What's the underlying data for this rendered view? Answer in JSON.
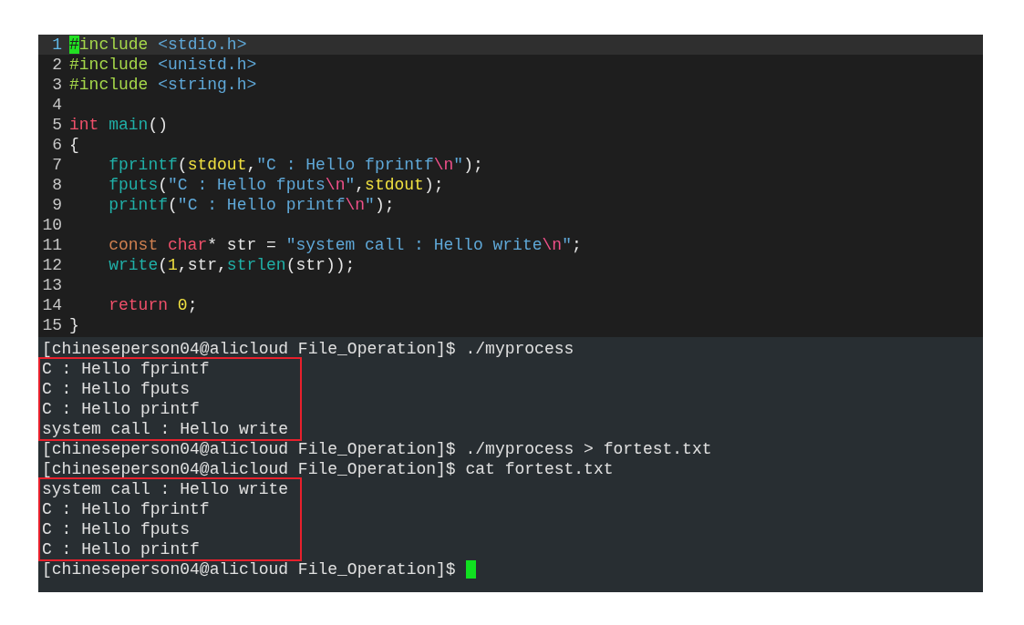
{
  "editor": {
    "lines": [
      {
        "number": "1",
        "current": true,
        "tokens": [
          {
            "kind": "cursor",
            "text": "#"
          },
          {
            "kind": "preproc",
            "text": "include"
          },
          {
            "kind": "string",
            "text": " <stdio.h>"
          }
        ]
      },
      {
        "number": "2",
        "current": false,
        "tokens": [
          {
            "kind": "preproc",
            "text": "#include"
          },
          {
            "kind": "string",
            "text": " <unistd.h>"
          }
        ]
      },
      {
        "number": "3",
        "current": false,
        "tokens": [
          {
            "kind": "preproc",
            "text": "#include"
          },
          {
            "kind": "string",
            "text": " <string.h>"
          }
        ]
      },
      {
        "number": "4",
        "current": false
      },
      {
        "number": "5",
        "current": false,
        "tokens": [
          {
            "kind": "keyword",
            "text": "int"
          },
          {
            "kind": "function",
            "text": " main"
          },
          {
            "kind": "plain",
            "text": "()"
          }
        ]
      },
      {
        "number": "6",
        "current": false,
        "tokens": [
          {
            "kind": "plain",
            "text": "{"
          }
        ]
      },
      {
        "number": "7",
        "current": false,
        "tokens": [
          {
            "kind": "function",
            "text": "    fprintf"
          },
          {
            "kind": "plain",
            "text": "("
          },
          {
            "kind": "identifier",
            "text": "stdout"
          },
          {
            "kind": "plain",
            "text": ","
          },
          {
            "kind": "string",
            "text": "\"C : Hello fprintf"
          },
          {
            "kind": "escape",
            "text": "\\n"
          },
          {
            "kind": "string",
            "text": "\""
          },
          {
            "kind": "plain",
            "text": ");"
          }
        ]
      },
      {
        "number": "8",
        "current": false,
        "tokens": [
          {
            "kind": "function",
            "text": "    fputs"
          },
          {
            "kind": "plain",
            "text": "("
          },
          {
            "kind": "string",
            "text": "\"C : Hello fputs"
          },
          {
            "kind": "escape",
            "text": "\\n"
          },
          {
            "kind": "string",
            "text": "\""
          },
          {
            "kind": "plain",
            "text": ","
          },
          {
            "kind": "identifier",
            "text": "stdout"
          },
          {
            "kind": "plain",
            "text": ");"
          }
        ]
      },
      {
        "number": "9",
        "current": false,
        "tokens": [
          {
            "kind": "function",
            "text": "    printf"
          },
          {
            "kind": "plain",
            "text": "("
          },
          {
            "kind": "string",
            "text": "\"C : Hello printf"
          },
          {
            "kind": "escape",
            "text": "\\n"
          },
          {
            "kind": "string",
            "text": "\""
          },
          {
            "kind": "plain",
            "text": ");"
          }
        ]
      },
      {
        "number": "10",
        "current": false
      },
      {
        "number": "11",
        "current": false,
        "tokens": [
          {
            "kind": "qualifier",
            "text": "    const"
          },
          {
            "kind": "keyword",
            "text": " char"
          },
          {
            "kind": "plain",
            "text": "* str = "
          },
          {
            "kind": "string",
            "text": "\"system call : Hello write"
          },
          {
            "kind": "escape",
            "text": "\\n"
          },
          {
            "kind": "string",
            "text": "\""
          },
          {
            "kind": "plain",
            "text": ";"
          }
        ]
      },
      {
        "number": "12",
        "current": false,
        "tokens": [
          {
            "kind": "function",
            "text": "    write"
          },
          {
            "kind": "plain",
            "text": "("
          },
          {
            "kind": "number",
            "text": "1"
          },
          {
            "kind": "plain",
            "text": ",str,"
          },
          {
            "kind": "function",
            "text": "strlen"
          },
          {
            "kind": "plain",
            "text": "(str));"
          }
        ]
      },
      {
        "number": "13",
        "current": false
      },
      {
        "number": "14",
        "current": false,
        "tokens": [
          {
            "kind": "keyword",
            "text": "    return"
          },
          {
            "kind": "number",
            "text": " 0"
          },
          {
            "kind": "plain",
            "text": ";"
          }
        ]
      },
      {
        "number": "15",
        "current": false,
        "tokens": [
          {
            "kind": "plain",
            "text": "}"
          }
        ]
      }
    ]
  },
  "terminal": {
    "blocks": [
      {
        "kind": "prompt",
        "text": "[chineseperson04@alicloud File_Operation]$ ./myprocess",
        "cursor": false
      },
      {
        "kind": "output",
        "boxed": true,
        "lines": [
          "C : Hello fprintf",
          "C : Hello fputs",
          "C : Hello printf",
          "system call : Hello write"
        ]
      },
      {
        "kind": "prompt",
        "text": "[chineseperson04@alicloud File_Operation]$ ./myprocess > fortest.txt",
        "cursor": false
      },
      {
        "kind": "prompt",
        "text": "[chineseperson04@alicloud File_Operation]$ cat fortest.txt",
        "cursor": false
      },
      {
        "kind": "output",
        "boxed": true,
        "lines": [
          "system call : Hello write",
          "C : Hello fprintf",
          "C : Hello fputs",
          "C : Hello printf"
        ]
      },
      {
        "kind": "prompt",
        "text": "[chineseperson04@alicloud File_Operation]$",
        "cursor": true
      }
    ]
  }
}
